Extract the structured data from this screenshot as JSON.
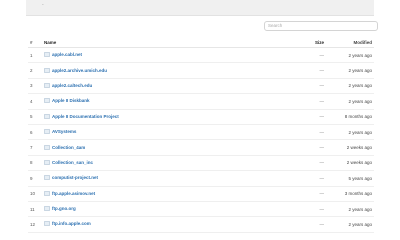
{
  "topbar": {
    "crumb": "-"
  },
  "search": {
    "placeholder": "Search"
  },
  "table": {
    "headers": {
      "num": "#",
      "name": "Name",
      "size": "Size",
      "modified": "Modified"
    },
    "rows": [
      {
        "num": "1",
        "name": "apple.cabl.net",
        "size": "—",
        "modified": "2 years ago"
      },
      {
        "num": "2",
        "name": "apple2.archive.umich.edu",
        "size": "—",
        "modified": "2 years ago"
      },
      {
        "num": "3",
        "name": "apple2.caltech.edu",
        "size": "—",
        "modified": "2 years ago"
      },
      {
        "num": "4",
        "name": "Apple II Diskbank",
        "size": "—",
        "modified": "2 years ago"
      },
      {
        "num": "5",
        "name": "Apple II Documentation Project",
        "size": "—",
        "modified": "8 months ago"
      },
      {
        "num": "6",
        "name": "AVSystems",
        "size": "—",
        "modified": "2 years ago"
      },
      {
        "num": "7",
        "name": "Collection_4am",
        "size": "—",
        "modified": "2 weeks ago"
      },
      {
        "num": "8",
        "name": "Collection_san_inc",
        "size": "—",
        "modified": "2 weeks ago"
      },
      {
        "num": "9",
        "name": "computist-project.net",
        "size": "—",
        "modified": "5 years ago"
      },
      {
        "num": "10",
        "name": "ftp.apple.asimov.net",
        "size": "—",
        "modified": "3 months ago"
      },
      {
        "num": "11",
        "name": "ftp.gno.org",
        "size": "—",
        "modified": "2 years ago"
      },
      {
        "num": "12",
        "name": "ftp.info.apple.com",
        "size": "—",
        "modified": "2 years ago"
      }
    ]
  }
}
